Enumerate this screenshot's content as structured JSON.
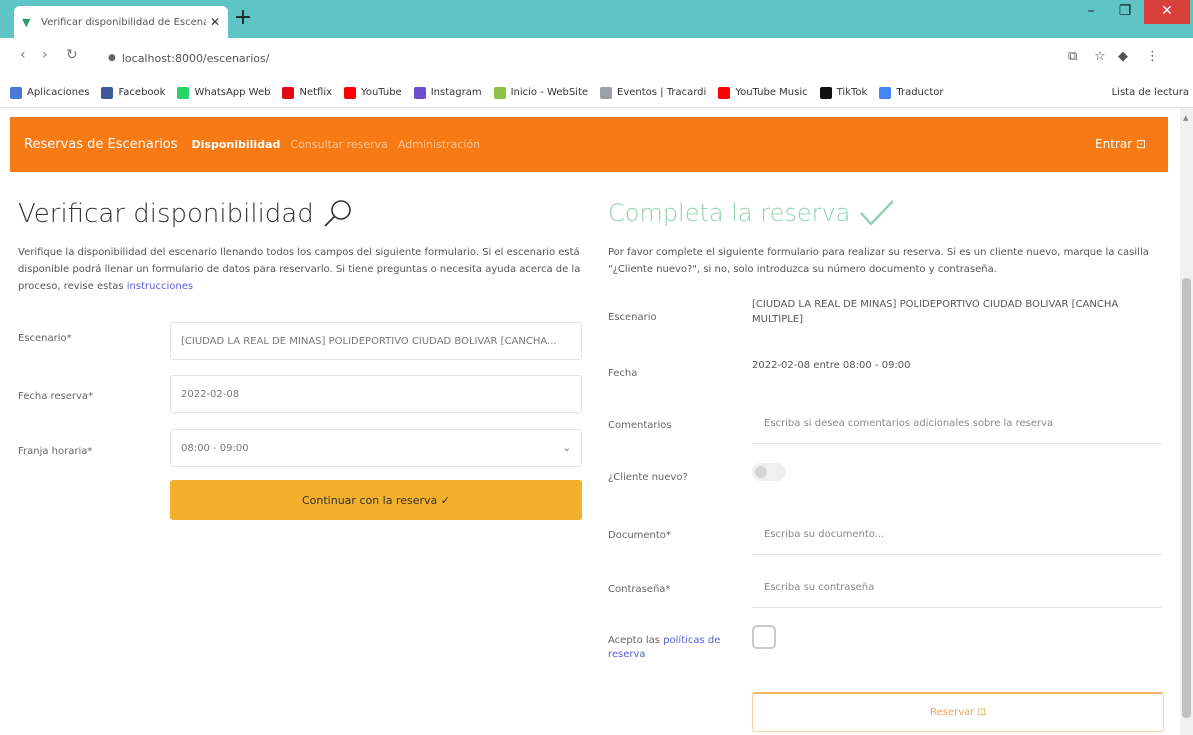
{
  "browser": {
    "tab_title": "Verificar disponibilidad de Escenarios",
    "tab_close": "✕",
    "new_tab": "+",
    "url": "localhost:8000/escenarios/",
    "window_controls": {
      "minimize": "–",
      "maximize": "❐",
      "close": "✕"
    },
    "bookmarks": [
      {
        "label": "Aplicaciones",
        "color": "#4a78d6"
      },
      {
        "label": "Facebook",
        "color": "#3b5998"
      },
      {
        "label": "WhatsApp Web",
        "color": "#25d366"
      },
      {
        "label": "Netflix",
        "color": "#e50914"
      },
      {
        "label": "YouTube",
        "color": "#ff0000"
      },
      {
        "label": "Instagram",
        "color": "#6c4fd1"
      },
      {
        "label": "Inicio - WebSite",
        "color": "#8bc34a"
      },
      {
        "label": "Eventos | Tracardi",
        "color": "#9aa0a6"
      },
      {
        "label": "YouTube Music",
        "color": "#ff0000"
      },
      {
        "label": "TikTok",
        "color": "#111111"
      },
      {
        "label": "Traductor",
        "color": "#4285f4"
      }
    ],
    "other_bookmarks": "Lista de lectura"
  },
  "site": {
    "brand": "Reservas de Escenarios",
    "nav_links": [
      "Disponibilidad",
      "Consultar reserva",
      "Administración"
    ],
    "login": "Entrar ⊡"
  },
  "left": {
    "title": "Verificar disponibilidad",
    "description": "Verifique la disponibilidad del escenario llenando todos los campos del siguiente formulario. Si el escenario está disponible podrá llenar un formulario de datos para reservarlo. Si tiene preguntas o necesita ayuda acerca de la proceso, revise estas ",
    "description_link": "instrucciones",
    "fields": [
      {
        "label": "Escenario*",
        "value": "[CIUDAD LA REAL DE MINAS] POLIDEPORTIVO CIUDAD BOLIVAR [CANCHA..."
      },
      {
        "label": "Fecha reserva*",
        "value": "2022-02-08"
      },
      {
        "label": "Franja horaria*",
        "value": "08:00 - 09:00"
      }
    ],
    "select_chevron": "⌄",
    "continue_button": "Continuar con la reserva ✓"
  },
  "right": {
    "title": "Completa la reserva",
    "description": "Por favor complete el siguiente formulario para realizar su reserva. Si es un cliente nuevo, marque la casilla \"¿Cliente nuevo?\", si no, solo introduzca su número documento y contraseña.",
    "escenario_label": "Escenario",
    "escenario_value": "[CIUDAD LA REAL DE MINAS] POLIDEPORTIVO CIUDAD BOLIVAR [CANCHA MULTIPLE]",
    "fecha_label": "Fecha",
    "fecha_value": "2022-02-08 entre 08:00 - 09:00",
    "comentarios_label": "Comentarios",
    "comentarios_placeholder": "Escriba si desea comentarios adicionales sobre la reserva",
    "cliente_nuevo_label": "¿Cliente nuevo?",
    "documento_label": "Documento*",
    "documento_placeholder": "Escriba su documento...",
    "password_label": "Contraseña*",
    "password_placeholder": "Escriba su contraseña",
    "accept_label": "Acepto las ",
    "accept_link": "políticas de reserva",
    "reservar_button": "Reservar ⊡"
  }
}
